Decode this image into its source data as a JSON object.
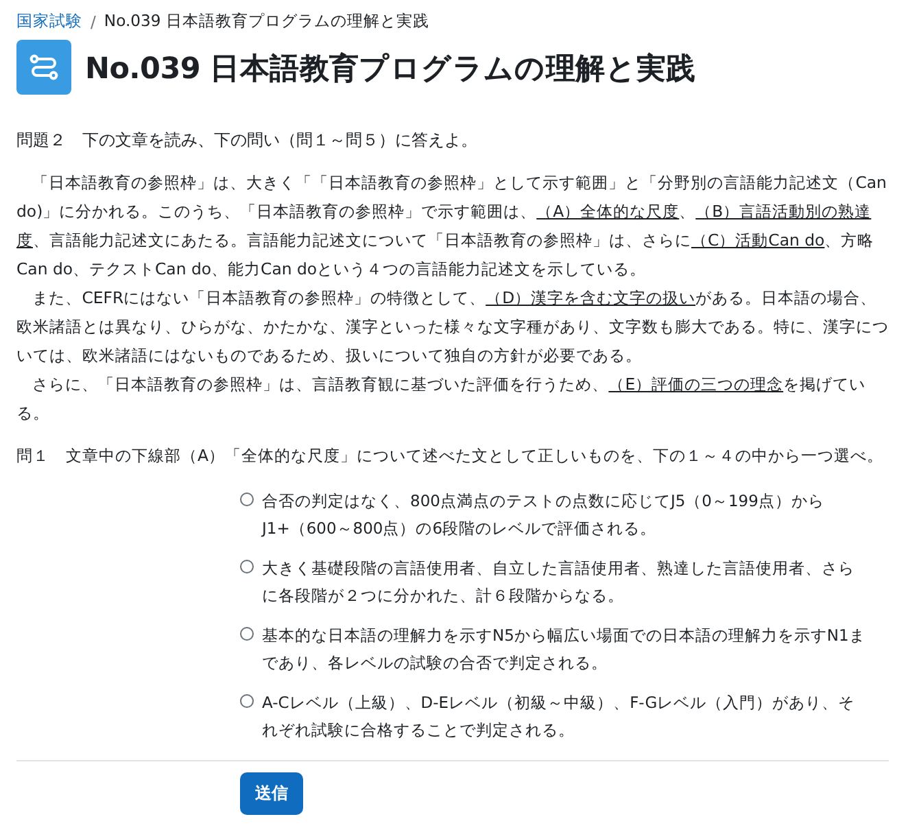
{
  "breadcrumb": [
    {
      "label": "国家試験",
      "link": true
    },
    {
      "label": "No.039 日本語教育プログラムの理解と実践",
      "link": false
    }
  ],
  "breadcrumb_separator": "/",
  "title": "No.039 日本語教育プログラムの理解と実践",
  "question_heading": "問題２　下の文章を読み、下の問い（問１～問５）に答えよ。",
  "passage": [
    [
      {
        "text": "「日本語教育の参照枠」は、大きく「「日本語教育の参照枠」として示す範囲」と「分野別の言語能力記述文（Can do)」に分かれる。このうち、「日本語教育の参照枠」で示す範囲は、",
        "underline": false
      },
      {
        "text": "（A）全体的な尺度",
        "underline": true
      },
      {
        "text": "、",
        "underline": false
      },
      {
        "text": "（B）言語活動別の熟達度",
        "underline": true
      },
      {
        "text": "、言語能力記述文にあたる。言語能力記述文について「日本語教育の参照枠」は、さらに",
        "underline": false
      },
      {
        "text": "（C）活動Can do",
        "underline": true
      },
      {
        "text": "、方略Can do、テクストCan do、能力Can doという４つの言語能力記述文を示している。",
        "underline": false
      }
    ],
    [
      {
        "text": "また、CEFRにはない「日本語教育の参照枠」の特徴として、",
        "underline": false
      },
      {
        "text": "（D）漢字を含む文字の扱い",
        "underline": true
      },
      {
        "text": "がある。日本語の場合、欧米諸語とは異なり、ひらがな、かたかな、漢字といった様々な文字種があり、文字数も膨大である。特に、漢字については、欧米諸語にはないものであるため、扱いについて独自の方針が必要である。",
        "underline": false
      }
    ],
    [
      {
        "text": "さらに、「日本語教育の参照枠」は、言語教育観に基づいた評価を行うため、",
        "underline": false
      },
      {
        "text": "（E）評価の三つの理念",
        "underline": true
      },
      {
        "text": "を掲げている。",
        "underline": false
      }
    ]
  ],
  "sub_question": "問１　文章中の下線部（A）「全体的な尺度」について述べた文として正しいものを、下の１～４の中から一つ選べ。",
  "options": [
    {
      "label": "合否の判定はなく、800点満点のテストの点数に応じてJ5（0～199点）から J1+（600～800点）の6段階のレベルで評価される。",
      "selected": false
    },
    {
      "label": "大きく基礎段階の言語使用者、自立した言語使用者、熟達した言語使用者、さらに各段階が２つに分かれた、計６段階からなる。",
      "selected": false
    },
    {
      "label": "基本的な日本語の理解力を示すN5から幅広い場面での日本語の理解力を示すN1まであり、各レベルの試験の合否で判定される。",
      "selected": false
    },
    {
      "label": "A-Cレベル（上級）、D-Eレベル（初級～中級）、F-Gレベル（入門）があり、それぞれ試験に合格することで判定される。",
      "selected": false
    }
  ],
  "submit_button": "送信"
}
